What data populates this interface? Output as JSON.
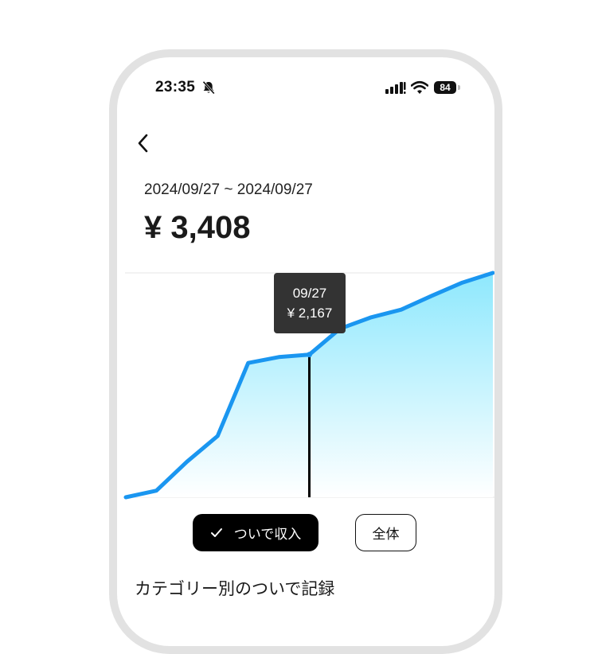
{
  "status_bar": {
    "time": "23:35",
    "battery": "84",
    "icons": [
      "bell-slash-icon",
      "cellular-signal-icon",
      "wifi-icon",
      "battery-icon"
    ]
  },
  "nav": {
    "back_icon": "chevron-left-icon"
  },
  "summary": {
    "date_range": "2024/09/27 ~ 2024/09/27",
    "total": "¥ 3,408"
  },
  "tooltip": {
    "date": "09/27",
    "value": "¥ 2,167"
  },
  "filters": {
    "active_label": "ついで収入",
    "active_icon": "checkmark-icon",
    "all_label": "全体"
  },
  "section": {
    "title": "カテゴリー別のついで記録"
  },
  "colors": {
    "line": "#1a96f0",
    "fill_top": "#8ee8fd",
    "fill_bottom": "#ffffff",
    "cursor": "#000000",
    "tooltip_bg": "#333333"
  },
  "chart_data": {
    "type": "area",
    "title": "",
    "xlabel": "",
    "ylabel": "",
    "x": [
      0,
      1,
      2,
      3,
      4,
      5,
      6,
      7,
      8,
      9,
      10,
      11,
      12
    ],
    "values": [
      0,
      100,
      540,
      930,
      2040,
      2130,
      2167,
      2560,
      2730,
      2850,
      3060,
      3260,
      3408
    ],
    "ylim": [
      0,
      3408
    ],
    "highlight_index": 6,
    "grid": false
  }
}
